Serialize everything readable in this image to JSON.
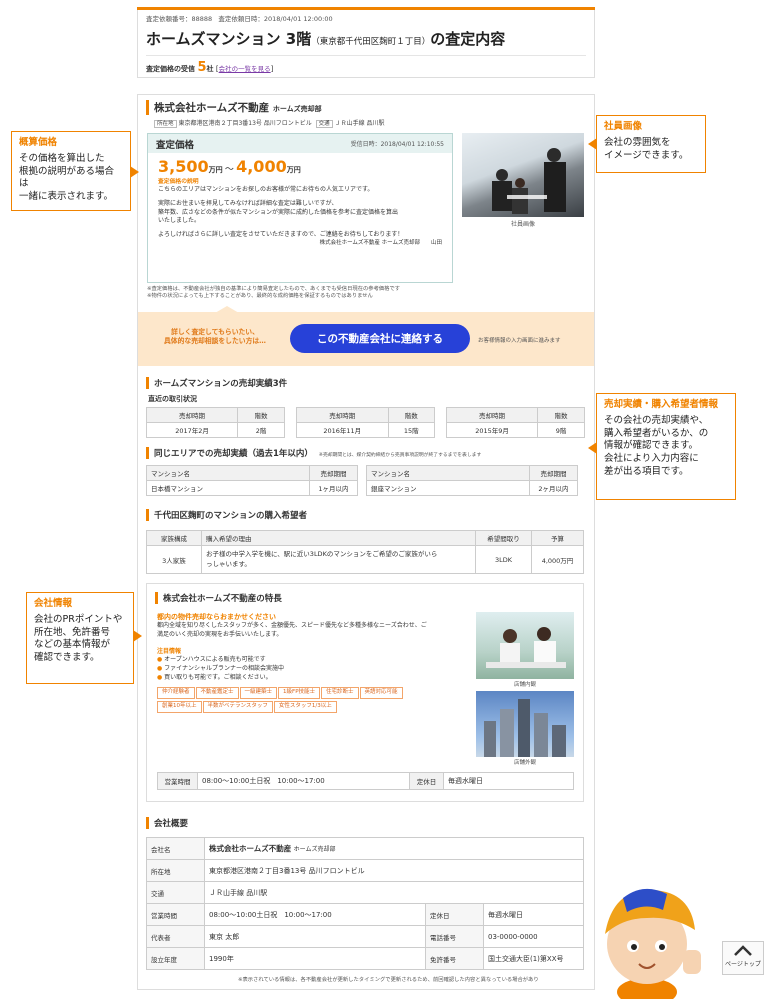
{
  "header": {
    "request_no_label": "査定依頼番号：",
    "request_no": "88888",
    "request_date_label": "査定依頼日時：",
    "request_date": "2018/04/01 12:00:00",
    "title_main": "ホームズマンション 3階",
    "title_addr": "（東京都千代田区麹町１丁目）",
    "title_tail": "の査定内容",
    "received_label": "査定価格の受信",
    "received_count": "5",
    "received_unit": "社",
    "company_list_link": "会社の一覧を見る"
  },
  "company": {
    "name": "株式会社ホームズ不動産",
    "branch": "ホームズ売却部",
    "addr_tag": "所在地",
    "address": "東京都港区港南２丁目3番13号 品川フロントビル",
    "access_tag": "交通",
    "access": "ＪＲ山手線 品川駅"
  },
  "estimate": {
    "title": "査定価格",
    "received_time": "受信日時：2018/04/01 12:10:55",
    "price_low": "3,500",
    "price_high": "4,000",
    "unit": "万円",
    "tilde": "～",
    "desc_title": "査定価格の説明",
    "desc_1": "こちらのエリアはマンションをお探しのお客様が常にお待ちの人気エリアです。",
    "desc_2": "実際にお住まいを拝見してみなければ詳細な査定は難しいですが、",
    "desc_3": "築年数、広さなどの条件が似たマンションが実際に成約した価格を参考に査定価格を算出",
    "desc_4": "いたしました。",
    "desc_5": "よろしければさらに詳しい査定をさせていただきますので、ご連絡をお待ちしております！",
    "signature": "株式会社ホームズ不動産 ホームズ売却部　　山田",
    "note_1": "※査定価格は、不動産会社が独自の基準により簡易査定したもので、あくまでも受信日現在の参考価格です",
    "note_2": "※物件の状況によっても上下することがあり、最終的な成約価格を保証するものではありません"
  },
  "staff_photo_caption": "社員画像",
  "cta": {
    "lead_1": "詳しく査定してもらいたい、",
    "lead_2": "具体的な売却相談をしたい方は…",
    "button": "この不動産会社に連絡する",
    "side_note": "お客様情報の入力画面に進みます"
  },
  "sales": {
    "heading": "ホームズマンションの売却実績3件",
    "sub": "直近の取引状況",
    "col_time": "売却時期",
    "col_floor": "階数",
    "items": [
      {
        "time": "2017年2月",
        "floor": "2階"
      },
      {
        "time": "2016年11月",
        "floor": "15階"
      },
      {
        "time": "2015年9月",
        "floor": "9階"
      }
    ]
  },
  "area": {
    "heading": "同じエリアでの売却実績（過去1年以内）",
    "note": "※売却期間とは、媒介契約締結から売買事項説明が終了するまでを表します",
    "col_name": "マンション名",
    "col_period": "売却期間",
    "items": [
      {
        "name": "日本橋マンション",
        "period": "1ヶ月以内"
      },
      {
        "name": "銀座マンション",
        "period": "2ヶ月以内"
      }
    ]
  },
  "buyers": {
    "heading": "千代田区麹町のマンションの購入希望者",
    "cols": [
      "家族構成",
      "購入希望の理由",
      "希望間取り",
      "予算"
    ],
    "family": "3人家族",
    "reason_1": "お子様の中学入学を機に、駅に近い3LDKのマンションをご希望のご家族がいら",
    "reason_2": "っしゃいます。",
    "layout": "3LDK",
    "budget": "4,000万円"
  },
  "features": {
    "heading": "株式会社ホームズ不動産の特長",
    "catch": "都内の物件売却ならおまかせください",
    "text_1": "都内全域を知り尽くしたスタッフが多く、金額優先、スピード優先など多種多様なニーズ合わせ、ご",
    "text_2": "満足のいく売却の実現をお手伝いいたします。",
    "notice_title": "注目情報",
    "notice": [
      "オープンハウスによる販売も可能です",
      "ファイナンシャルプランナーの相談会実施中",
      "買い取りも可能です。ご相談ください。"
    ],
    "tags_row1": [
      "仲介経験者",
      "不動産鑑定士",
      "一級建築士",
      "1級FP技能士",
      "住宅診断士",
      "英語対応可能"
    ],
    "tags_row2": [
      "創業10年以上",
      "半数がベテランスタッフ",
      "女性スタッフ1/3以上"
    ],
    "photo1_caption": "店舗内観",
    "photo2_caption": "店舗外観",
    "hours_label": "営業時間",
    "hours": "08:00～10:00土日祝　10:00～17:00",
    "holiday_label": "定休日",
    "holiday": "毎週水曜日"
  },
  "overview": {
    "heading": "会社概要",
    "name_label": "会社名",
    "name": "株式会社ホームズ不動産",
    "name_sub": "ホームズ売却部",
    "addr_label": "所在地",
    "addr": "東京都港区港南２丁目3番13号 品川フロントビル",
    "access_label": "交通",
    "access": "ＪＲ山手線 品川駅",
    "hours_label": "営業時間",
    "hours": "08:00～10:00土日祝　10:00～17:00",
    "holiday_label": "定休日",
    "holiday": "毎週水曜日",
    "rep_label": "代表者",
    "rep": "東京 太郎",
    "tel_label": "電話番号",
    "tel": "03-0000-0000",
    "est_label": "設立年度",
    "est": "1990年",
    "license_label": "免許番号",
    "license": "国土交通大臣(1)第XX号",
    "footnote": "※表示されている情報は、各不動産会社が更新したタイミングで更新されるため、前回確認した内容と異なっている場合があり"
  },
  "callouts": {
    "price": {
      "title": "概算価格",
      "l1": "その価格を算出した",
      "l2": "根拠の説明がある場合は",
      "l3": "一緒に表示されます。"
    },
    "staff": {
      "title": "社員画像",
      "l1": "会社の雰囲気を",
      "l2": "イメージできます。"
    },
    "sales": {
      "title": "売却実績・購入希望者情報",
      "l1": "その会社の売却実績や、",
      "l2": "購入希望者がいるか、の",
      "l3": "情報が確認できます。",
      "l4": "会社により入力内容に",
      "l5": "差が出る項目です。"
    },
    "company": {
      "title": "会社情報",
      "l1": "会社のPRポイントや",
      "l2": "所在地、免許番号",
      "l3": "などの基本情報が",
      "l4": "確認できます。"
    }
  },
  "page_top": "ページトップ",
  "colors": {
    "accent": "#f08300",
    "cta_button": "#2741d8",
    "estimate_bg": "#e6f2f1",
    "cta_bg": "#fde7cb"
  }
}
